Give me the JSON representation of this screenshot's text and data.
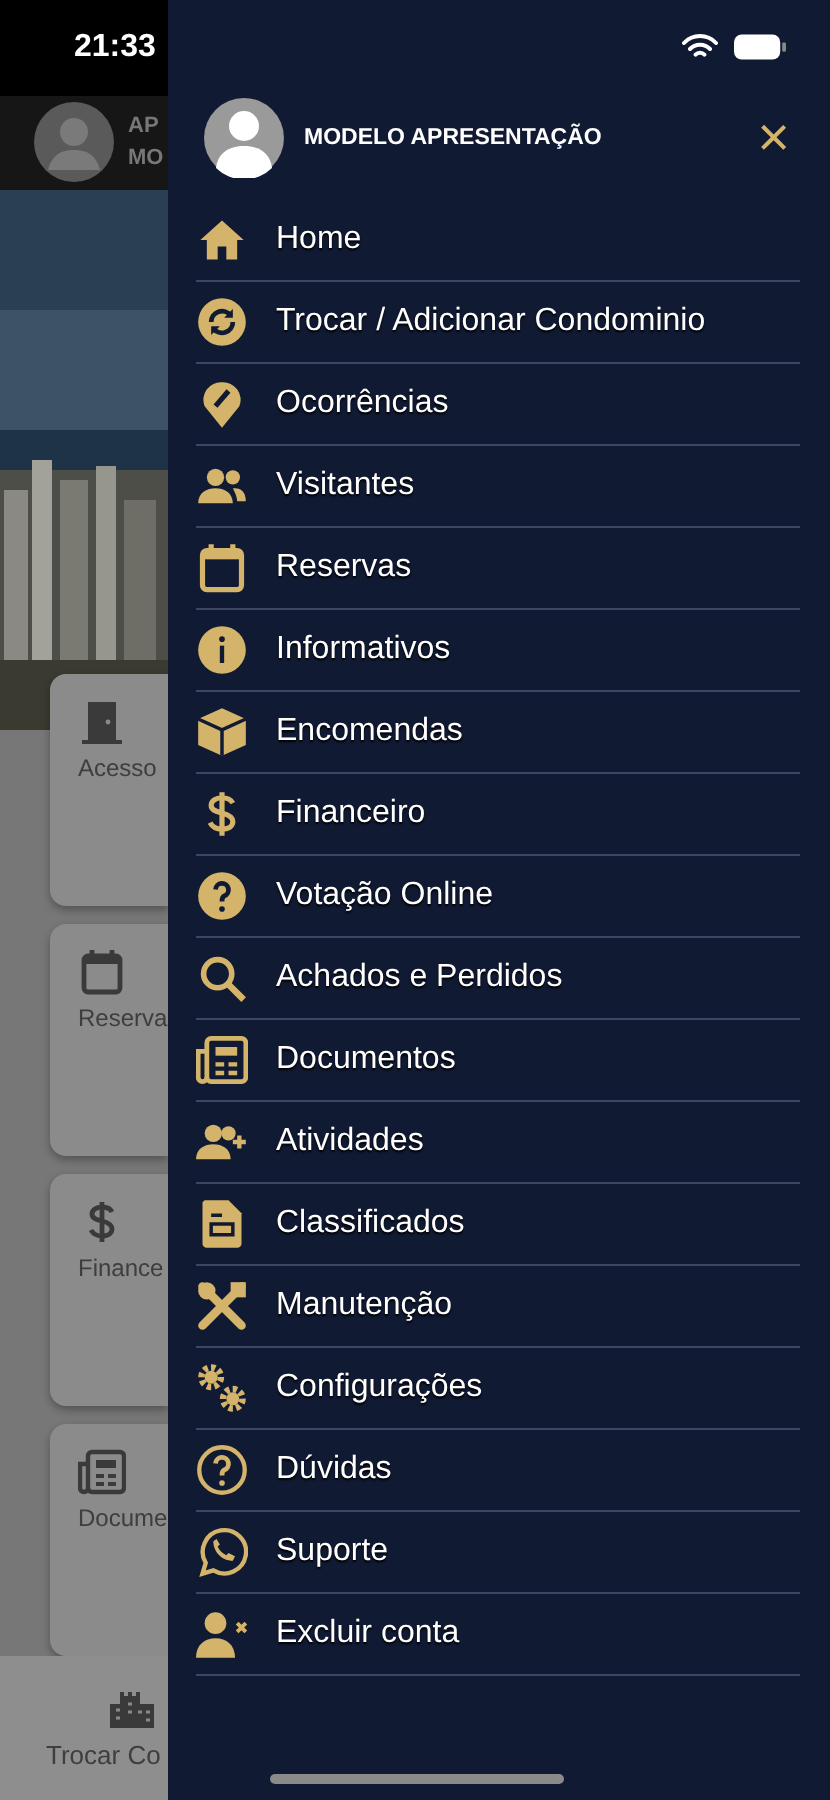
{
  "status_bar": {
    "time": "21:33"
  },
  "background_app": {
    "header": {
      "line_1": "AP",
      "line_2": "MO"
    },
    "cards": [
      {
        "label": "Acesso"
      },
      {
        "label": "Reserva"
      },
      {
        "label": "Finance"
      },
      {
        "label": "Docume"
      }
    ],
    "tab_bar": {
      "label": "Trocar Co"
    }
  },
  "drawer": {
    "user_name": "MODELO APRESENTAÇÃO",
    "close": "×",
    "items": [
      {
        "label": "Home"
      },
      {
        "label": "Trocar / Adicionar Condominio"
      },
      {
        "label": "Ocorrências"
      },
      {
        "label": "Visitantes"
      },
      {
        "label": "Reservas"
      },
      {
        "label": "Informativos"
      },
      {
        "label": "Encomendas"
      },
      {
        "label": "Financeiro"
      },
      {
        "label": "Votação Online"
      },
      {
        "label": "Achados e Perdidos"
      },
      {
        "label": "Documentos"
      },
      {
        "label": "Atividades"
      },
      {
        "label": "Classificados"
      },
      {
        "label": "Manutenção"
      },
      {
        "label": "Configurações"
      },
      {
        "label": "Dúvidas"
      },
      {
        "label": "Suporte"
      },
      {
        "label": "Excluir conta"
      }
    ]
  }
}
